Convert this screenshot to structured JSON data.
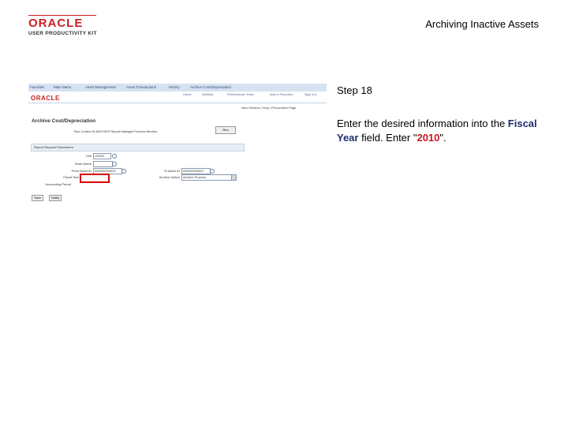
{
  "header": {
    "brand": "ORACLE",
    "product": "USER PRODUCTIVITY KIT",
    "title": "Archiving Inactive Assets"
  },
  "instruction": {
    "step_label": "Step 18",
    "text_pre": "Enter the desired information into the ",
    "field_name": "Fiscal Year",
    "text_mid": " field. Enter \"",
    "value": "2010",
    "text_post": "\"."
  },
  "screenshot": {
    "brand": "ORACLE",
    "nav_items": [
      "Favorites",
      "Main Menu",
      "Asset Management",
      "Asset Transactions",
      "History",
      "Archive Cost/Depreciation"
    ],
    "top_menu": [
      "Home",
      "Worklist",
      "Performance Trace",
      "Add to Favorites",
      "Sign out"
    ],
    "new_window": "New Window | Help | Personalize Page",
    "page_title": "Archive Cost/Depreciation",
    "sub_line": "Run Control ID   ARCHIVE   Report Manager   Process Monitor",
    "run_button": "Run",
    "group_title": "Report Request Parameters",
    "fields": {
      "unit_label": "Unit",
      "unit_value": "US001",
      "book_label": "Book Name",
      "from_asset_label": "From Asset ID",
      "from_asset_value": "000000000001",
      "to_asset_label": "To Asset ID",
      "to_asset_value": "000000000047",
      "fiscal_year_label": "Fiscal Year",
      "period_label": "Accounting Period",
      "option_label": "Archive Option",
      "option_value": "Archive Process"
    },
    "buttons": [
      "Save",
      "Notify"
    ]
  }
}
